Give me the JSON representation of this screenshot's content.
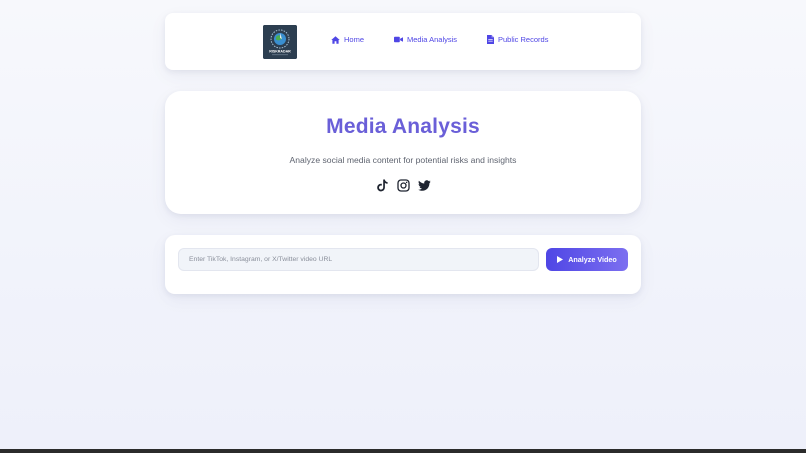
{
  "nav": {
    "logo_text": "RISKRADAR",
    "logo_icon": "radar-globe-logo",
    "items": [
      {
        "label": "Home",
        "icon": "home-icon"
      },
      {
        "label": "Media Analysis",
        "icon": "video-camera-icon"
      },
      {
        "label": "Public Records",
        "icon": "document-icon"
      }
    ],
    "accent_color": "#4f46e5"
  },
  "hero": {
    "title": "Media Analysis",
    "subtitle": "Analyze social media content for potential risks and insights",
    "social_icons": [
      "tiktok-icon",
      "instagram-icon",
      "twitter-icon"
    ],
    "title_color": "#6a5fd8"
  },
  "search": {
    "placeholder": "Enter TikTok, Instagram, or X/Twitter video URL",
    "value": "",
    "button_label": "Analyze Video",
    "button_icon": "play-icon"
  }
}
